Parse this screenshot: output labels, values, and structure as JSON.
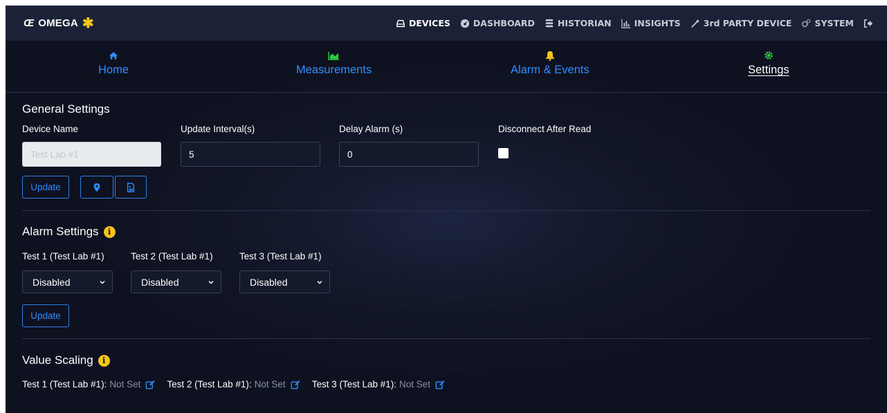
{
  "brand": {
    "name": "OMEGA",
    "mark": "Œ",
    "star": "✱"
  },
  "topnav": [
    {
      "label": "DEVICES",
      "icon": "hdd-icon",
      "active": true
    },
    {
      "label": "DASHBOARD",
      "icon": "dashboard-icon",
      "active": false
    },
    {
      "label": "HISTORIAN",
      "icon": "database-icon",
      "active": false
    },
    {
      "label": "INSIGHTS",
      "icon": "bar-chart-icon",
      "active": false
    },
    {
      "label": "3rd PARTY DEVICE",
      "icon": "magic-wand-icon",
      "active": false
    },
    {
      "label": "SYSTEM",
      "icon": "cogs-icon",
      "active": false
    }
  ],
  "tabs": [
    {
      "label": "Home",
      "icon": "home-icon",
      "color": "#2f8cff"
    },
    {
      "label": "Measurements",
      "icon": "area-chart-icon",
      "color": "#2ecc40"
    },
    {
      "label": "Alarm & Events",
      "icon": "bell-icon",
      "color": "#f5c518"
    },
    {
      "label": "Settings",
      "icon": "gear-icon",
      "color": "#2ecc40",
      "active": true
    }
  ],
  "general": {
    "title": "General Settings",
    "device_name_label": "Device Name",
    "device_name_value": "Test Lab #1",
    "update_interval_label": "Update Interval(s)",
    "update_interval_value": "5",
    "delay_alarm_label": "Delay Alarm (s)",
    "delay_alarm_value": "0",
    "disconnect_label": "Disconnect After Read",
    "disconnect_checked": false,
    "update_button": "Update"
  },
  "alarm": {
    "title": "Alarm Settings",
    "channels": [
      {
        "label": "Test 1 (Test Lab #1)",
        "value": "Disabled"
      },
      {
        "label": "Test 2 (Test Lab #1)",
        "value": "Disabled"
      },
      {
        "label": "Test 3 (Test Lab #1)",
        "value": "Disabled"
      }
    ],
    "update_button": "Update"
  },
  "scaling": {
    "title": "Value Scaling",
    "items": [
      {
        "label": "Test 1 (Test Lab #1):",
        "value": "Not Set"
      },
      {
        "label": "Test 2 (Test Lab #1):",
        "value": "Not Set"
      },
      {
        "label": "Test 3 (Test Lab #1):",
        "value": "Not Set"
      }
    ]
  },
  "colors": {
    "accent": "#2f8cff",
    "warning": "#f5c518",
    "success": "#2ecc40",
    "navbar": "#1b2238"
  }
}
